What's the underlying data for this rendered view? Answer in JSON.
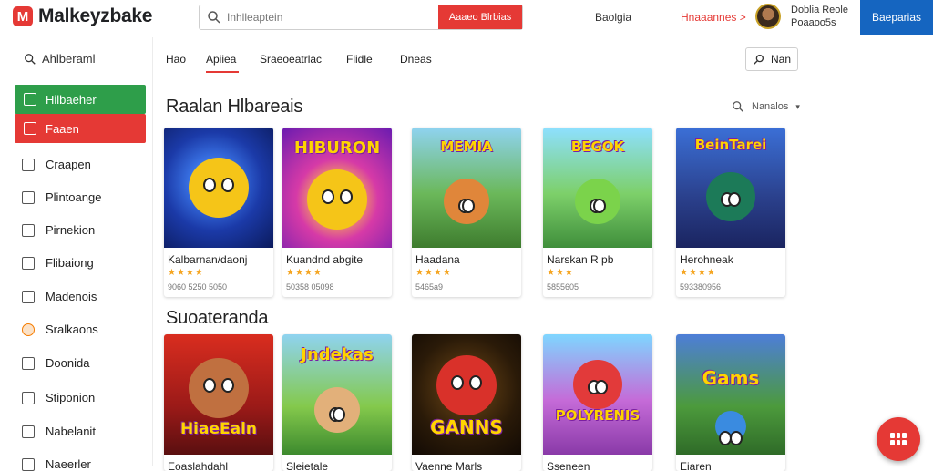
{
  "app": {
    "logo_letter": "M",
    "name": "Malkeyzbake"
  },
  "search": {
    "placeholder": "Inhlleaptein",
    "button_label": "Aaaeo Blrbias"
  },
  "header": {
    "link_1": "Baolgia",
    "link_2": "Hnaaannes >",
    "user_line_1": "Doblia Reole",
    "user_line_2": "Poaaoo5s",
    "signin_label": "Baeparias"
  },
  "sidebar": {
    "search_label": "Ahlberaml",
    "primary_items": [
      {
        "label": "Hilbaeher"
      },
      {
        "label": "Faaen"
      }
    ],
    "items": [
      {
        "label": "Craapen"
      },
      {
        "label": "Plintoange"
      },
      {
        "label": "Pirnekion"
      },
      {
        "label": "Flibaiong"
      },
      {
        "label": "Madenois"
      },
      {
        "label": "Sralkaons"
      },
      {
        "label": "Doonida"
      },
      {
        "label": "Stiponion"
      },
      {
        "label": "Nabelanit"
      },
      {
        "label": "Naeerler"
      }
    ]
  },
  "tabs": [
    {
      "label": "Hao"
    },
    {
      "label": "Apiiea"
    },
    {
      "label": "Sraeoeatrlac"
    },
    {
      "label": "Flidle"
    },
    {
      "label": "Dneas"
    }
  ],
  "toolbar": {
    "new_label": "Nan"
  },
  "sections": [
    {
      "title": "Raalan Hlbareais",
      "sort_label": "Nanalos",
      "cards": [
        {
          "thumb_text": "",
          "title": "Kalbarnan/daonj",
          "stars": "★★★★",
          "meta": "9060 5250 5050",
          "bg": "radial-gradient(circle at 45% 45%, #3f7df0 0 20%, #1b3aa8 55%, #0b1a5c 100%)",
          "face": "#f5c518"
        },
        {
          "thumb_text": "HIBURON",
          "title": "Kuandnd abgite",
          "stars": "★★★★",
          "meta": "50358 05098",
          "bg": "radial-gradient(circle at 50% 60%, #ffcf3e 0 15%, #d63aa7 45%, #6a1bb0 100%)",
          "face": "#f5c518"
        },
        {
          "thumb_text": "MEMIA",
          "title": "Haadana",
          "stars": "★★★★",
          "meta": "5465a9",
          "bg": "linear-gradient(180deg, #8fd3f0 0%, #6bb85a 55%, #3e7c2e 100%)",
          "face": "#e0863a"
        },
        {
          "thumb_text": "BEGOK",
          "title": "Narskan R pb",
          "stars": "★★★",
          "meta": "5855605",
          "bg": "linear-gradient(180deg, #8ee0ff 0%, #7dd06a 55%, #3f8e3b 100%)",
          "face": "#7bd34b"
        },
        {
          "thumb_text": "BeinTarei",
          "title": "Herohneak",
          "stars": "★★★★",
          "meta": "593380956",
          "bg": "linear-gradient(180deg, #3b6fd6 0%, #2a3f8a 60%, #1a2460 100%)",
          "face": "#1c7a58"
        }
      ]
    },
    {
      "title": "Suoateranda",
      "cards": [
        {
          "thumb_text": "HiaeEaln",
          "title": "Eoaslahdahl",
          "bg": "linear-gradient(180deg, #d92d1f 0%, #9b1a18 60%, #5a0f10 100%)",
          "face": "#c07040"
        },
        {
          "thumb_text": "Jndekas",
          "title": "Sleietale",
          "bg": "linear-gradient(180deg, #8fd3f0 0%, #84c94c 60%, #3d8a2e 100%)",
          "face": "#e2b07a"
        },
        {
          "thumb_text": "GANNS",
          "title": "Vaenne Marls",
          "bg": "radial-gradient(circle at 50% 45%, #5a3a12 0 20%, #2a1a08 60%, #120a04 100%)",
          "face": "#d9312a"
        },
        {
          "thumb_text": "POLYRENIS",
          "title": "Sseneen",
          "bg": "linear-gradient(180deg, #7fd6ff 0%, #c56bd8 55%, #8a3aa8 100%)",
          "face": "#e23a3a"
        },
        {
          "thumb_text": "Gams",
          "title": "Eiaren",
          "bg": "linear-gradient(180deg, #4d7ed8 0%, #4c9a3c 60%, #2f6b28 100%)",
          "face": "#3a8be0"
        }
      ]
    }
  ]
}
